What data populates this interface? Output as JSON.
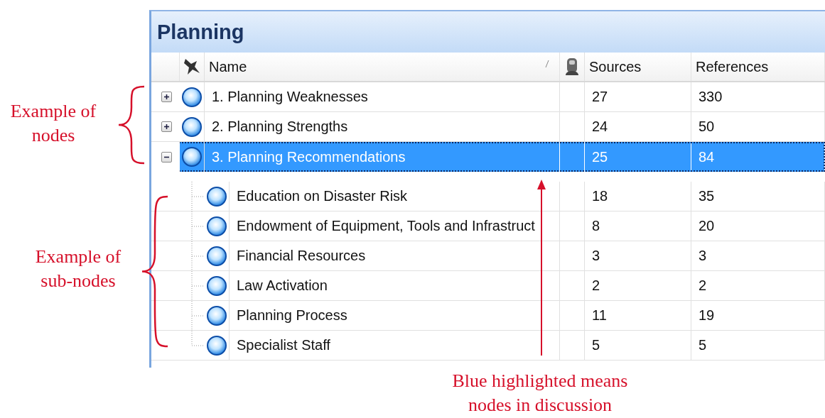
{
  "panel": {
    "title": "Planning"
  },
  "columns": [
    {
      "kind": "name",
      "label": "Name",
      "sorted": true
    },
    {
      "kind": "sources",
      "label": "Sources"
    },
    {
      "kind": "references",
      "label": "References"
    }
  ],
  "nodes": [
    {
      "name": "1. Planning Weaknesses",
      "sources": "27",
      "references": "330",
      "selected": false,
      "expanded": false
    },
    {
      "name": "2. Planning Strengths",
      "sources": "24",
      "references": "50",
      "selected": false,
      "expanded": false
    },
    {
      "name": "3. Planning Recommendations",
      "sources": "25",
      "references": "84",
      "selected": true,
      "expanded": true,
      "children": [
        {
          "name": "Education on Disaster Risk",
          "sources": "18",
          "references": "35",
          "selected": false
        },
        {
          "name": "Endowment of Equipment, Tools and Infrastruct",
          "sources": "8",
          "references": "20",
          "selected": false
        },
        {
          "name": "Financial Resources",
          "sources": "3",
          "references": "3",
          "selected": false
        },
        {
          "name": "Law Activation",
          "sources": "2",
          "references": "2",
          "selected": false
        },
        {
          "name": "Planning Process",
          "sources": "11",
          "references": "19",
          "selected": false
        },
        {
          "name": "Specialist Staff",
          "sources": "5",
          "references": "5",
          "selected": false
        }
      ]
    }
  ],
  "annotations": [
    {
      "kind": "nodes-brace",
      "text": "Example of nodes"
    },
    {
      "kind": "subnodes-brace",
      "text": "Example of sub-nodes"
    },
    {
      "kind": "arrow",
      "text": "Blue highlighted means nodes in discussion"
    }
  ]
}
